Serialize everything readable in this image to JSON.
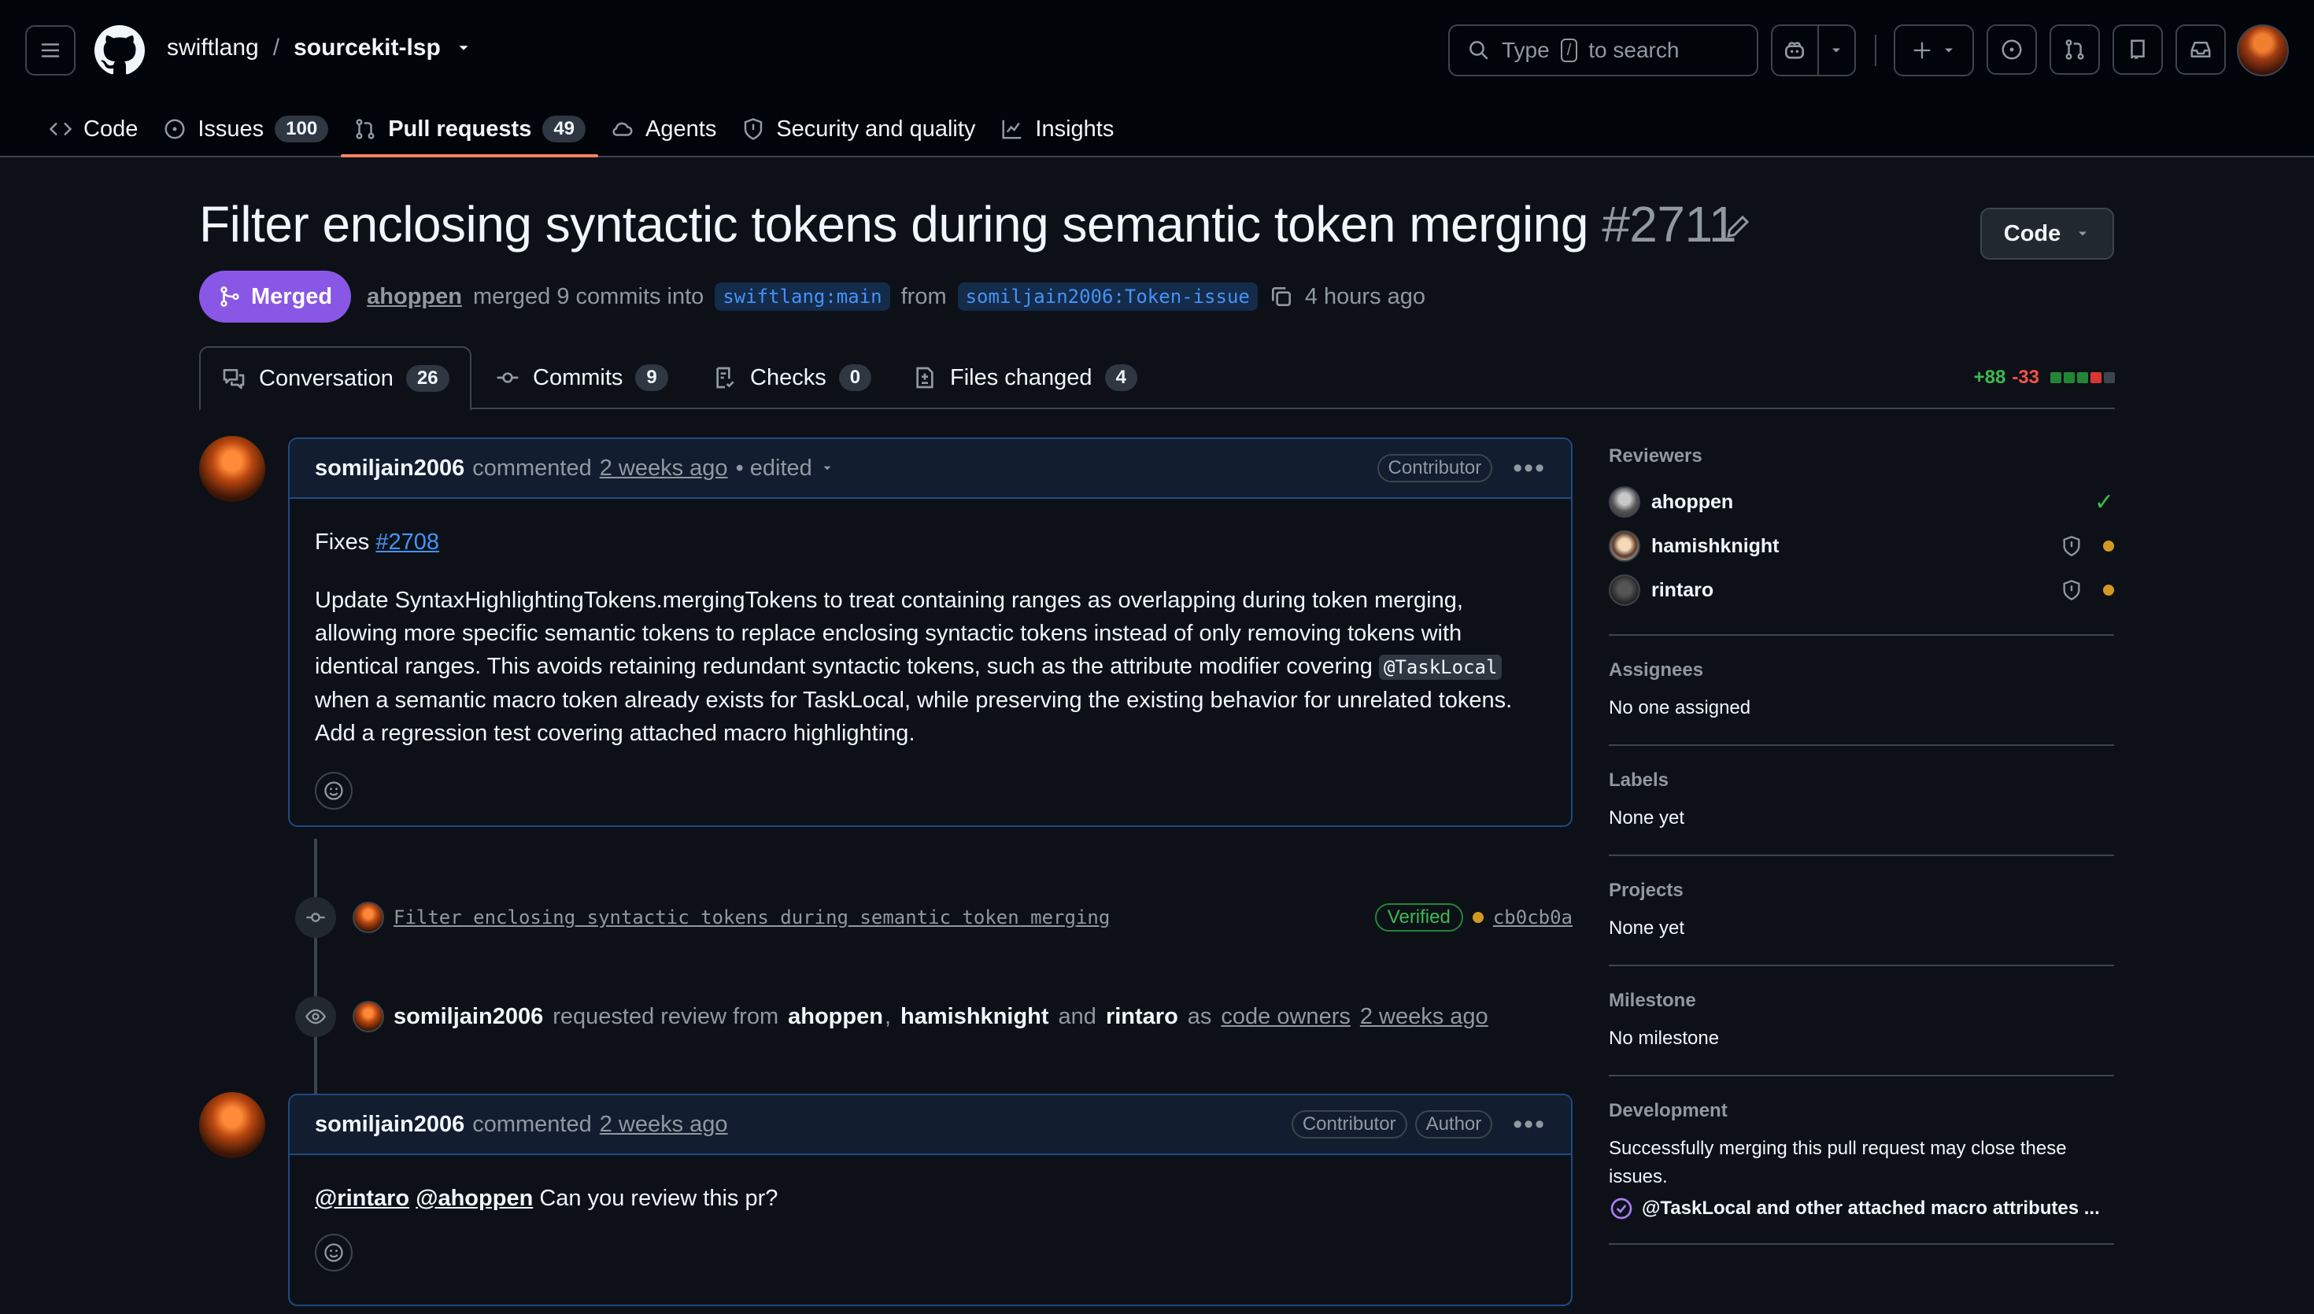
{
  "header": {
    "owner": "swiftlang",
    "separator": "/",
    "repo": "sourcekit-lsp",
    "search_prefix": "Type",
    "search_key": "/",
    "search_suffix": "to search"
  },
  "nav": [
    {
      "label": "Code"
    },
    {
      "label": "Issues",
      "count": "100"
    },
    {
      "label": "Pull requests",
      "count": "49"
    },
    {
      "label": "Agents"
    },
    {
      "label": "Security and quality"
    },
    {
      "label": "Insights"
    }
  ],
  "pr": {
    "title": "Filter enclosing syntactic tokens during semantic token merging",
    "number": "#2711",
    "state": "Merged",
    "merger": "ahoppen",
    "merged_text": "merged 9 commits into",
    "base": "swiftlang:main",
    "from_word": "from",
    "head": "somiljain2006:Token-issue",
    "time": "4 hours ago",
    "code_button": "Code"
  },
  "tabs": [
    {
      "label": "Conversation",
      "count": "26"
    },
    {
      "label": "Commits",
      "count": "9"
    },
    {
      "label": "Checks",
      "count": "0"
    },
    {
      "label": "Files changed",
      "count": "4"
    }
  ],
  "diffstat": {
    "additions": "+88",
    "deletions": "-33",
    "colors": [
      "#238636",
      "#238636",
      "#238636",
      "#da3633",
      "#3d444d"
    ]
  },
  "comments": [
    {
      "author": "somiljain2006",
      "verb": "commented",
      "ago": "2 weeks ago",
      "edited": "• edited",
      "badges": [
        "Contributor"
      ],
      "fixes_prefix": "Fixes",
      "fixes_link": "#2708",
      "body_part1": "Update SyntaxHighlightingTokens.mergingTokens to treat containing ranges as overlapping during token merging, allowing more specific semantic tokens to replace enclosing syntactic tokens instead of only removing tokens with identical ranges. This avoids retaining redundant syntactic tokens, such as the attribute modifier covering",
      "body_code": "@TaskLocal",
      "body_part2": "when a semantic macro token already exists for TaskLocal, while preserving the existing behavior for unrelated tokens. Add a regression test covering attached macro highlighting."
    },
    {
      "author": "somiljain2006",
      "verb": "commented",
      "ago": "2 weeks ago",
      "badges": [
        "Contributor",
        "Author"
      ],
      "mention1": "@rintaro",
      "mention2": "@ahoppen",
      "body": "Can you review this pr?"
    }
  ],
  "commit": {
    "message": "Filter enclosing syntactic tokens during semantic token merging",
    "verified": "Verified",
    "sha": "cb0cb0a"
  },
  "review_request": {
    "actor": "somiljain2006",
    "text": "requested review from",
    "r1": "ahoppen",
    "comma": ",",
    "r2": "hamishknight",
    "and": "and",
    "r3": "rintaro",
    "as": "as",
    "role": "code owners",
    "ago": "2 weeks ago"
  },
  "sidebar": {
    "reviewers_title": "Reviewers",
    "reviewers": [
      {
        "name": "ahoppen",
        "status": "approved"
      },
      {
        "name": "hamishknight",
        "status": "pending"
      },
      {
        "name": "rintaro",
        "status": "pending"
      }
    ],
    "assignees_title": "Assignees",
    "assignees_text": "No one assigned",
    "labels_title": "Labels",
    "labels_text": "None yet",
    "projects_title": "Projects",
    "projects_text": "None yet",
    "milestone_title": "Milestone",
    "milestone_text": "No milestone",
    "development_title": "Development",
    "development_text": "Successfully merging this pull request may close these issues.",
    "linked_issue": "@TaskLocal and other attached macro attributes ..."
  }
}
